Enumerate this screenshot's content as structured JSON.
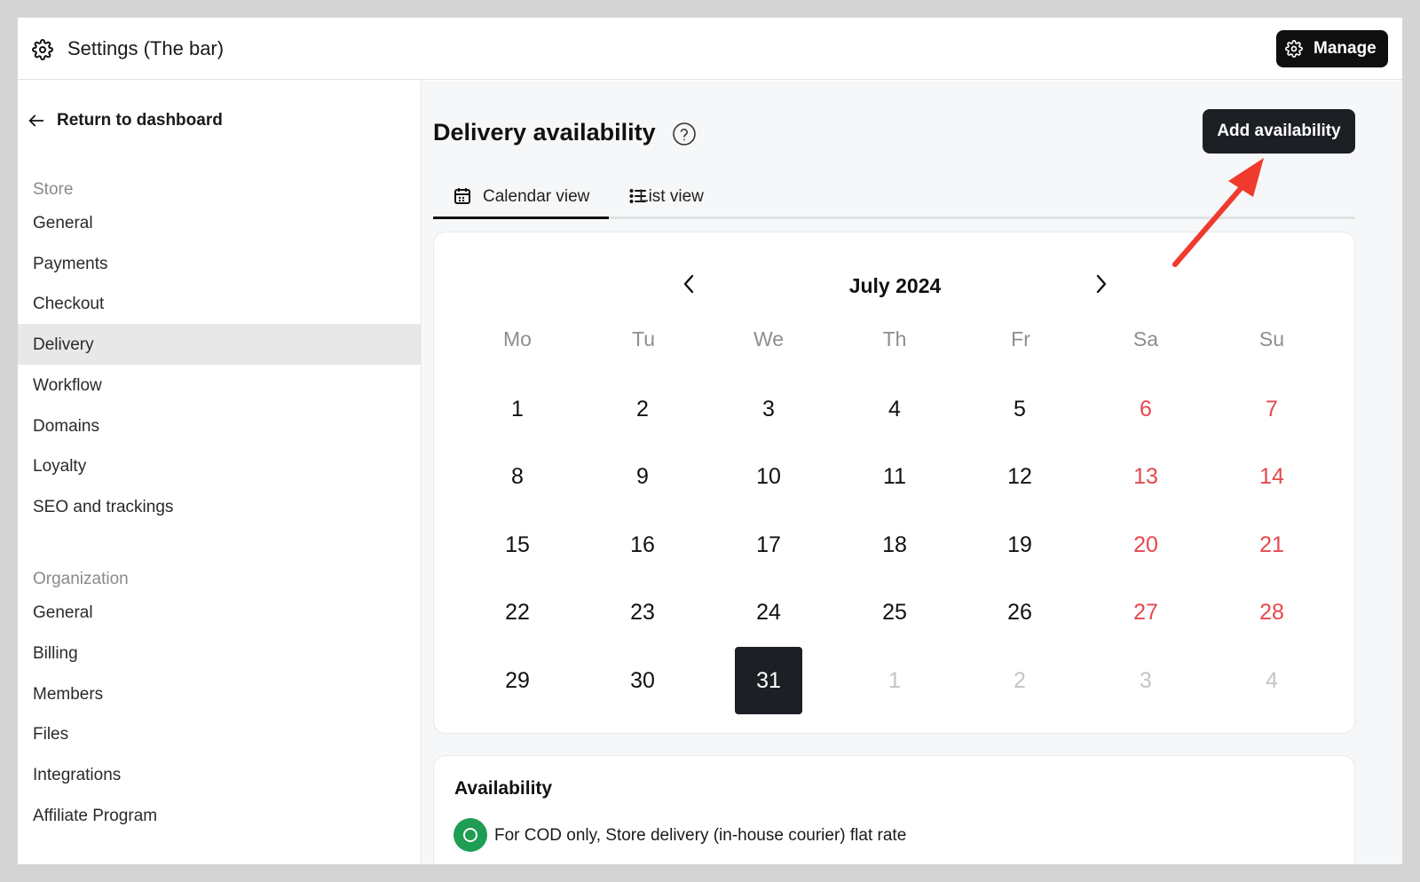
{
  "header": {
    "title": "Settings (The bar)",
    "manage_label": "Manage",
    "icon": "gear-icon"
  },
  "sidebar": {
    "back_label": "Return to dashboard",
    "store_label": "Store",
    "store_items": [
      {
        "label": "General"
      },
      {
        "label": "Payments"
      },
      {
        "label": "Checkout"
      },
      {
        "label": "Delivery",
        "active": true
      },
      {
        "label": "Workflow"
      },
      {
        "label": "Domains"
      },
      {
        "label": "Loyalty"
      },
      {
        "label": "SEO and trackings"
      }
    ],
    "org_label": "Organization",
    "org_items": [
      {
        "label": "General"
      },
      {
        "label": "Billing"
      },
      {
        "label": "Members"
      },
      {
        "label": "Files"
      },
      {
        "label": "Integrations"
      },
      {
        "label": "Affiliate Program"
      }
    ]
  },
  "main": {
    "title": "Delivery availability",
    "add_label": "Add availability",
    "tabs": [
      {
        "label": "Calendar view",
        "icon": "calendar-icon",
        "active": true
      },
      {
        "label": "List view",
        "icon": "list-icon"
      }
    ],
    "calendar": {
      "month_label": "July 2024",
      "weekdays": [
        "Mo",
        "Tu",
        "We",
        "Th",
        "Fr",
        "Sa",
        "Su"
      ],
      "weeks": [
        [
          "1",
          "2",
          "3",
          "4",
          "5",
          "6",
          "7"
        ],
        [
          "8",
          "9",
          "10",
          "11",
          "12",
          "13",
          "14"
        ],
        [
          "15",
          "16",
          "17",
          "18",
          "19",
          "20",
          "21"
        ],
        [
          "22",
          "23",
          "24",
          "25",
          "26",
          "27",
          "28"
        ],
        [
          "29",
          "30",
          "31",
          "1",
          "2",
          "3",
          "4"
        ]
      ],
      "selected_day": "31",
      "weekend_color": "#e5484d"
    },
    "availability": {
      "title": "Availability",
      "items": [
        {
          "label": "For COD only, Store delivery (in-house courier) flat rate",
          "status_color": "#1f9d55"
        }
      ]
    }
  },
  "colors": {
    "accent": "#1c1f24",
    "annotation": "#f03a2e"
  }
}
